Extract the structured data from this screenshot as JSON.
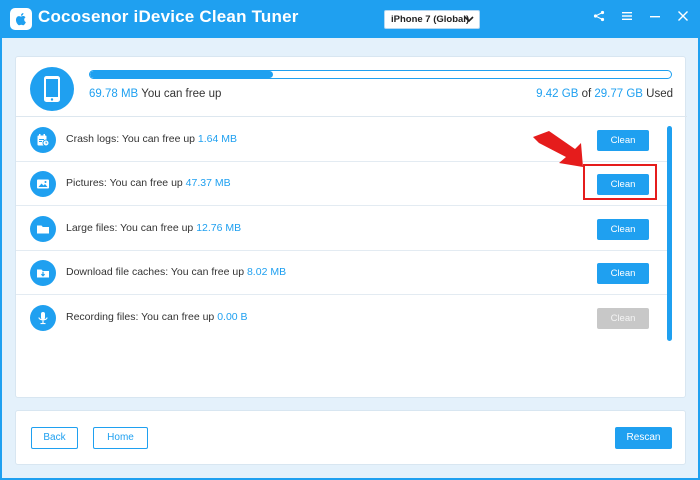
{
  "app": {
    "title": "Cocosenor iDevice Clean Tuner",
    "device_selected": "iPhone 7 (Global)"
  },
  "colors": {
    "accent": "#1fa0f0",
    "disabled": "#c8c8c8",
    "highlight": "#e51c1c"
  },
  "summary": {
    "free_amount": "69.78 MB",
    "free_suffix": " You can free up",
    "used_amount": "9.42 GB",
    "used_of": " of ",
    "total_amount": "29.77 GB",
    "used_suffix": " Used",
    "progress_fraction": 0.315
  },
  "items": [
    {
      "label": "Crash logs: You can free up ",
      "size": "1.64 MB",
      "button": "Clean",
      "icon": "crash-log-icon",
      "disabled": false
    },
    {
      "label": "Pictures: You can free up ",
      "size": "47.37 MB",
      "button": "Clean",
      "icon": "picture-icon",
      "disabled": false
    },
    {
      "label": "Large files: You can free up ",
      "size": "12.76 MB",
      "button": "Clean",
      "icon": "folder-icon",
      "disabled": false
    },
    {
      "label": "Download file caches: You can free up ",
      "size": "8.02 MB",
      "button": "Clean",
      "icon": "download-icon",
      "disabled": false
    },
    {
      "label": "Recording files: You can free up ",
      "size": "0.00 B",
      "button": "Clean",
      "icon": "microphone-icon",
      "disabled": true
    }
  ],
  "footer": {
    "back_label": "Back",
    "home_label": "Home",
    "rescan_label": "Rescan"
  }
}
